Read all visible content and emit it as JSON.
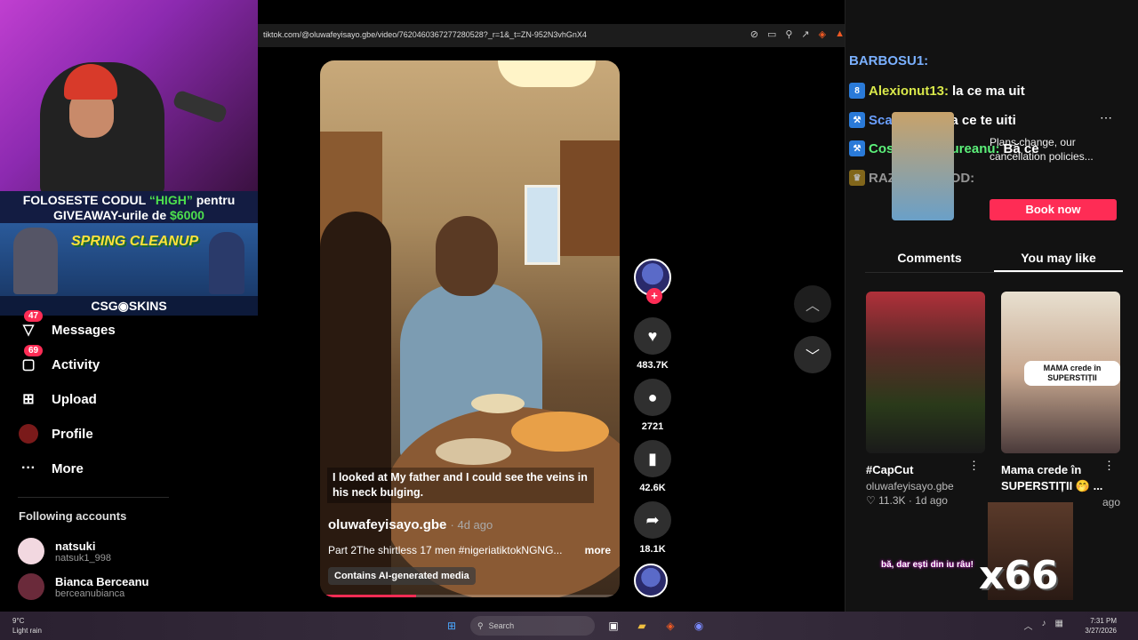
{
  "promo": {
    "line1_a": "FOLOSESTE CODUL ",
    "line1_code": "“HIGH”",
    "line1_b": " pentru",
    "line2_a": "GIVEAWAY-urile de ",
    "line2_amount": "$6000",
    "spring": "SPRING CLEANUP",
    "csg": "CSG◉SKINS"
  },
  "nav": {
    "messages": {
      "label": "Messages",
      "badge": "47"
    },
    "activity": {
      "label": "Activity",
      "badge": "69"
    },
    "upload": {
      "label": "Upload"
    },
    "profile": {
      "label": "Profile"
    },
    "more": {
      "label": "More"
    }
  },
  "following": {
    "title": "Following accounts",
    "accounts": [
      {
        "name": "natsuki",
        "handle": "natsuk1_998"
      },
      {
        "name": "Bianca Berceanu",
        "handle": "berceanubianca"
      }
    ]
  },
  "browser": {
    "url": "tiktok.com/@oluwafeyisayo.gbe/video/7620460367277280528?_r=1&_t=ZN-952N3vhGnX4"
  },
  "video": {
    "caption": "I looked at My father and I could see the veins in his neck bulging.",
    "author": "oluwafeyisayo.gbe",
    "date": "· 4d ago",
    "description": "Part 2The shirtless 17 men #nigeriatiktokNGNG...",
    "more": "more",
    "ai_label": "Contains AI-generated media",
    "progress": 0.32
  },
  "actions": {
    "likes": "483.7K",
    "comments": "2721",
    "saves": "42.6K",
    "shares": "18.1K"
  },
  "chat": [
    {
      "user": "BARBOSU1:",
      "msg": ""
    },
    {
      "user": "Alexionut13:",
      "msg": "la ce ma uit"
    },
    {
      "user": "Scar222:",
      "msg": "ba la ce te uiti"
    },
    {
      "user": "Cosmin_Ungureanu:",
      "msg": "Bă ce"
    },
    {
      "user": "RAZORTHE6OD:",
      "msg": ""
    }
  ],
  "ad": {
    "text": "Plans change, our cancellation policies...",
    "button": "Book now"
  },
  "tabs": {
    "comments": "Comments",
    "you_may_like": "You may like"
  },
  "cards": [
    {
      "title": "#CapCut",
      "author": "oluwafeyisayo.gbe",
      "likes": "♡ 11.3K",
      "age": "· 1d ago"
    },
    {
      "title": "Mama crede în SUPERSTIȚII 🤭 ...",
      "tag": "MAMA crede în SUPERSTIȚII",
      "age": "ago"
    }
  ],
  "meme": {
    "caption": "bă, dar ești din iu râu!",
    "counter": "x66"
  },
  "taskbar": {
    "temp": "9°C",
    "weather": "Light rain",
    "search": "Search",
    "time": "7:31 PM",
    "date": "3/27/2026"
  }
}
